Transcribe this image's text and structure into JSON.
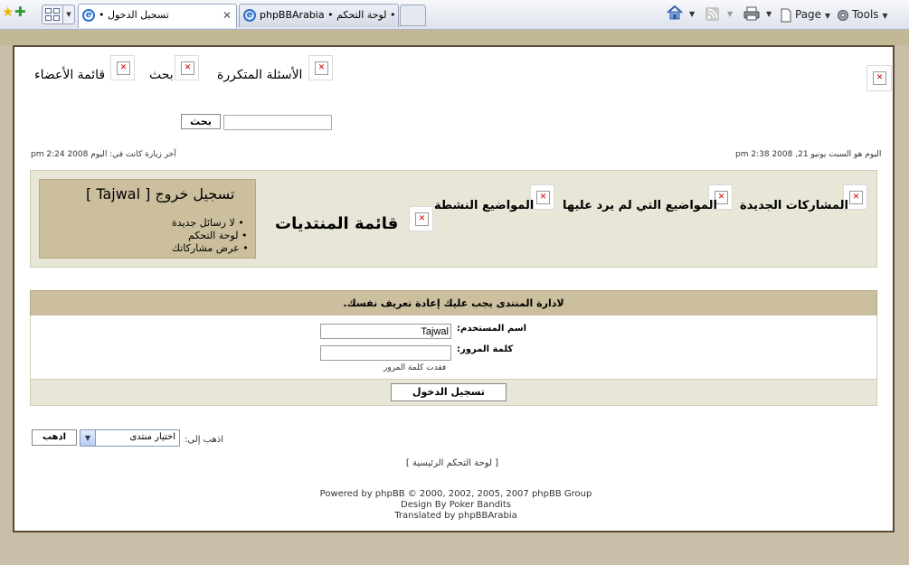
{
  "browser": {
    "tabs": [
      {
        "title": "تسجيل الدخول •"
      },
      {
        "title": "phpBBArabia • لوحة التحكم • ..."
      }
    ],
    "toolbar": {
      "page_label": "Page",
      "tools_label": "Tools"
    }
  },
  "header": {
    "nav": [
      {
        "label": "الأسئلة المتكررة"
      },
      {
        "label": "بحث"
      },
      {
        "label": "قائمة الأعضاء"
      }
    ],
    "search_button": "بحث",
    "search_placeholder": "",
    "current_time": "اليوم هو السبت يونيو 21, 2008 2:38 pm",
    "last_visit": "آخر زيارة كانت في: اليوم 2008 2:24 pm"
  },
  "nav_panel": {
    "links": [
      {
        "label": "المشاركات الجديدة"
      },
      {
        "label": "المواضيع التي لم يرد عليها"
      },
      {
        "label": "المواضيع النشطة"
      }
    ],
    "forum_index": "قائمة المنتديات",
    "user_box": {
      "logout": "تسجيل خروج [ Tajwal ]",
      "items": [
        "• لا رسائل جديدة",
        "• لوحة التحكم",
        "• عرض مشاركاتك"
      ]
    }
  },
  "login": {
    "header": "لادارة المنتدى يجب عليك إعادة تعريف نفسك.",
    "username_label": "اسم المستخدم:",
    "username_value": "Tajwal",
    "password_label": "كلمة المرور:",
    "password_value": "",
    "forgot_password": "فقدت كلمة المرور",
    "submit": "تسجيل الدخول"
  },
  "jumpbox": {
    "label": "اذهب إلى:",
    "selected": "اختيار منتدى",
    "go_button": "اذهب"
  },
  "footer": {
    "cp_link": "[ لوحة التحكم الرئيسية ]",
    "powered_by": "Powered by phpBB © 2000, 2002, 2005, 2007 phpBB Group",
    "design_by": "Design By Poker Bandits",
    "translated_by": "Translated by phpBBArabia"
  }
}
